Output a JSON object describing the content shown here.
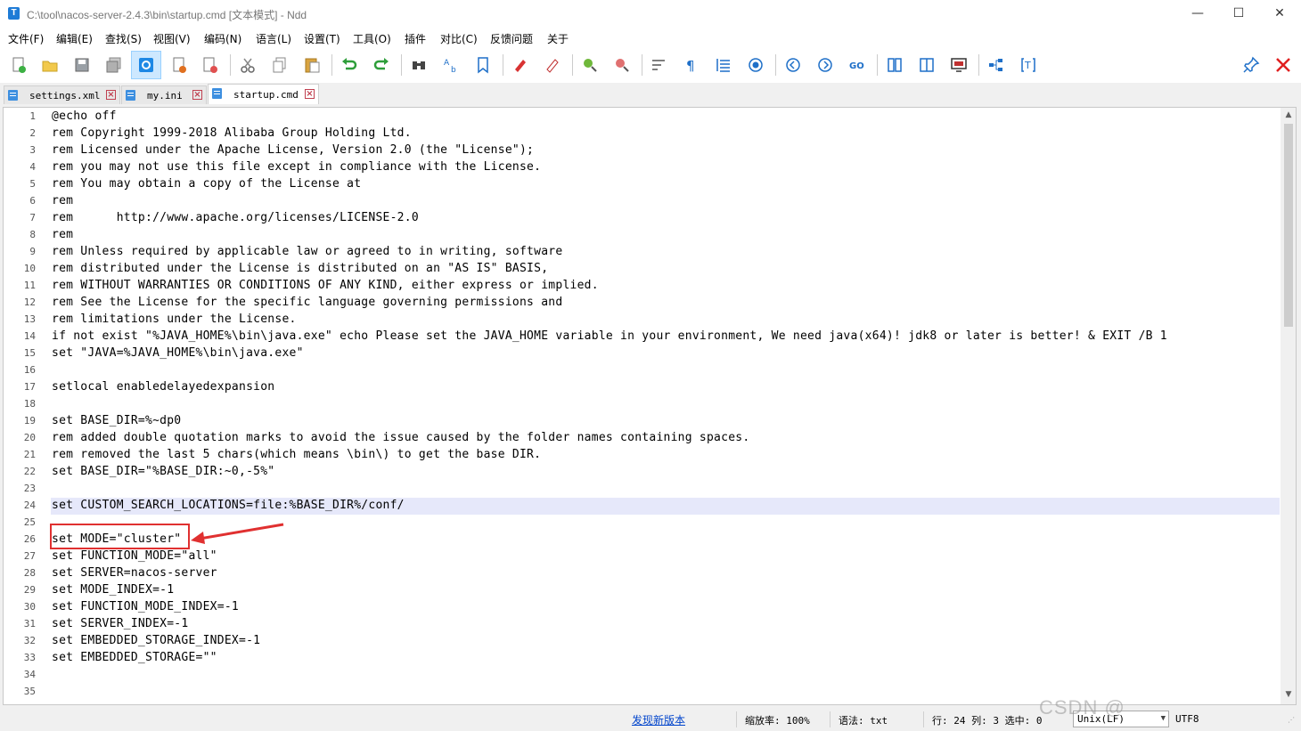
{
  "window": {
    "title": "C:\\tool\\nacos-server-2.4.3\\bin\\startup.cmd [文本模式] - Ndd",
    "app_icon_letter": "T",
    "minimize": "—",
    "maximize": "☐",
    "close": "✕"
  },
  "menu": [
    "文件(F)",
    "编辑(E)",
    "查找(S)",
    "视图(V)",
    "编码(N)",
    "语言(L)",
    "设置(T)",
    "工具(O)",
    "插件",
    "对比(C)",
    "反馈问题",
    "关于"
  ],
  "tabs": [
    {
      "label": "settings.xml",
      "close": "×"
    },
    {
      "label": "my.ini",
      "close": "×"
    },
    {
      "label": "startup.cmd",
      "close": "×"
    }
  ],
  "editor": {
    "lines": [
      {
        "n": "1",
        "text": "@echo off"
      },
      {
        "n": "2",
        "text": "rem Copyright 1999-2018 Alibaba Group Holding Ltd."
      },
      {
        "n": "3",
        "text": "rem Licensed under the Apache License, Version 2.0 (the \"License\");"
      },
      {
        "n": "4",
        "text": "rem you may not use this file except in compliance with the License."
      },
      {
        "n": "5",
        "text": "rem You may obtain a copy of the License at"
      },
      {
        "n": "6",
        "text": "rem"
      },
      {
        "n": "7",
        "text": "rem      http://www.apache.org/licenses/LICENSE-2.0"
      },
      {
        "n": "8",
        "text": "rem"
      },
      {
        "n": "9",
        "text": "rem Unless required by applicable law or agreed to in writing, software"
      },
      {
        "n": "10",
        "text": "rem distributed under the License is distributed on an \"AS IS\" BASIS,"
      },
      {
        "n": "11",
        "text": "rem WITHOUT WARRANTIES OR CONDITIONS OF ANY KIND, either express or implied."
      },
      {
        "n": "12",
        "text": "rem See the License for the specific language governing permissions and"
      },
      {
        "n": "13",
        "text": "rem limitations under the License."
      },
      {
        "n": "14",
        "text": "if not exist \"%JAVA_HOME%\\bin\\java.exe\" echo Please set the JAVA_HOME variable in your environment, We need java(x64)! jdk8 or later is better! & EXIT /B 1"
      },
      {
        "n": "15",
        "text": "set \"JAVA=%JAVA_HOME%\\bin\\java.exe\""
      },
      {
        "n": "16",
        "text": ""
      },
      {
        "n": "17",
        "text": "setlocal enabledelayedexpansion"
      },
      {
        "n": "18",
        "text": ""
      },
      {
        "n": "19",
        "text": "set BASE_DIR=%~dp0"
      },
      {
        "n": "20",
        "text": "rem added double quotation marks to avoid the issue caused by the folder names containing spaces."
      },
      {
        "n": "21",
        "text": "rem removed the last 5 chars(which means \\bin\\) to get the base DIR."
      },
      {
        "n": "22",
        "text": "set BASE_DIR=\"%BASE_DIR:~0,-5%\""
      },
      {
        "n": "23",
        "text": ""
      },
      {
        "n": "24",
        "text": "set CUSTOM_SEARCH_LOCATIONS=file:%BASE_DIR%/conf/"
      },
      {
        "n": "25",
        "text": ""
      },
      {
        "n": "26",
        "text": "set MODE=\"cluster\""
      },
      {
        "n": "27",
        "text": "set FUNCTION_MODE=\"all\""
      },
      {
        "n": "28",
        "text": "set SERVER=nacos-server"
      },
      {
        "n": "29",
        "text": "set MODE_INDEX=-1"
      },
      {
        "n": "30",
        "text": "set FUNCTION_MODE_INDEX=-1"
      },
      {
        "n": "31",
        "text": "set SERVER_INDEX=-1"
      },
      {
        "n": "32",
        "text": "set EMBEDDED_STORAGE_INDEX=-1"
      },
      {
        "n": "33",
        "text": "set EMBEDDED_STORAGE=\"\""
      },
      {
        "n": "34",
        "text": ""
      },
      {
        "n": "35",
        "text": ""
      }
    ],
    "current_line": 24
  },
  "status": {
    "update_link": "发现新版本",
    "zoom": "缩放率: 100%",
    "language": "语法: txt",
    "position": "行: 24 列: 3 选中: 0",
    "eol": "Unix(LF)",
    "encoding": "UTF8"
  },
  "watermark": "CSDN @",
  "colors": {
    "highlight_line": "#e6e8fa",
    "annotation_red": "#e03030",
    "link_blue": "#0044cc"
  }
}
